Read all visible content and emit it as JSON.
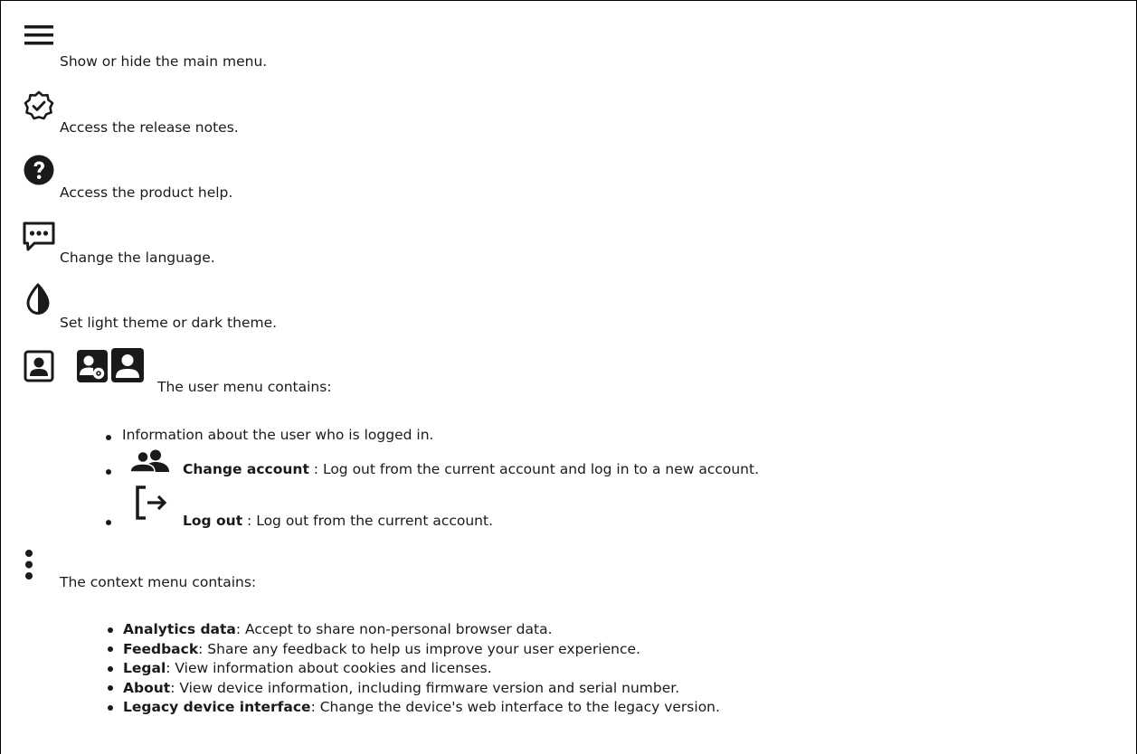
{
  "items": {
    "menu": {
      "icon": "hamburger-menu-icon",
      "text": "Show or hide the main menu."
    },
    "release": {
      "icon": "release-notes-badge-icon",
      "text": "Access the release notes."
    },
    "help": {
      "icon": "help-question-icon",
      "text": "Access the product help."
    },
    "language": {
      "icon": "language-chat-icon",
      "text": "Change the language."
    },
    "theme": {
      "icon": "theme-contrast-icon",
      "text": "Set light theme or dark theme."
    },
    "user": {
      "icons": [
        "user-portrait-icon",
        "user-admin-icon",
        "user-solid-icon"
      ],
      "text": "The user menu contains:",
      "bullets": [
        {
          "label": "",
          "desc": "Information about the user who is logged in."
        },
        {
          "icon": "change-account-icon",
          "label": "Change account",
          "desc": " : Log out from the current account and log in to a new account."
        },
        {
          "icon": "log-out-icon",
          "label": "Log out",
          "desc": " : Log out from the current account."
        }
      ]
    },
    "context": {
      "icon": "more-vertical-icon",
      "text": "The context menu contains:",
      "bullets": [
        {
          "label": "Analytics data",
          "desc": ": Accept to share non-personal browser data."
        },
        {
          "label": "Feedback",
          "desc": ": Share any feedback to help us improve your user experience."
        },
        {
          "label": "Legal",
          "desc": ": View information about cookies and licenses."
        },
        {
          "label": "About",
          "desc": ": View device information, including firmware version and serial number."
        },
        {
          "label": "Legacy device interface",
          "desc": ": Change the device's web interface to the legacy version."
        }
      ]
    }
  }
}
